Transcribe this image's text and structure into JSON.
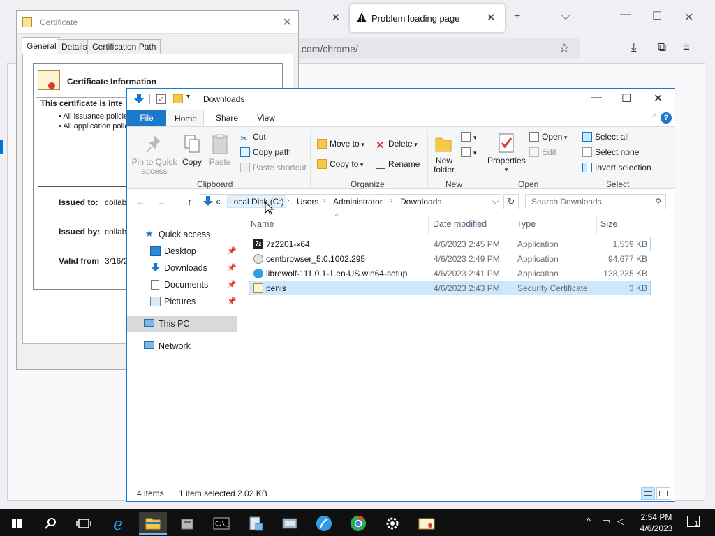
{
  "browser": {
    "tab_title": "Problem loading page",
    "url_fragment": ".com/chrome/"
  },
  "certificate": {
    "window_title": "Certificate",
    "tabs": [
      "General",
      "Details",
      "Certification Path"
    ],
    "heading": "Certificate Information",
    "intended": "This certificate is inte",
    "bullets": [
      "• All issuance policie",
      "• All application polic"
    ],
    "issued_to_label": "Issued to:",
    "issued_to_value": "collabr",
    "issued_by_label": "Issued by:",
    "issued_by_value": "collabr",
    "valid_from_label": "Valid from",
    "valid_from_value": "3/16/2"
  },
  "explorer": {
    "title": "Downloads",
    "ribbon_tabs": {
      "file": "File",
      "home": "Home",
      "share": "Share",
      "view": "View"
    },
    "clipboard": {
      "pin": "Pin to Quick access",
      "copy": "Copy",
      "paste": "Paste",
      "cut": "Cut",
      "copy_path": "Copy path",
      "paste_shortcut": "Paste shortcut",
      "label": "Clipboard"
    },
    "organize": {
      "move_to": "Move to",
      "copy_to": "Copy to",
      "delete": "Delete",
      "rename": "Rename",
      "label": "Organize"
    },
    "new_group": {
      "new_folder": "New folder",
      "label": "New"
    },
    "open_group": {
      "properties": "Properties",
      "open": "Open",
      "edit": "Edit",
      "label": "Open"
    },
    "select_group": {
      "select_all": "Select all",
      "select_none": "Select none",
      "invert": "Invert selection",
      "label": "Select"
    },
    "address": {
      "overflow": "«",
      "segments": [
        "Local Disk (C:)",
        "Users",
        "Administrator",
        "Downloads"
      ]
    },
    "search_placeholder": "Search Downloads",
    "nav": {
      "quick_access": "Quick access",
      "desktop": "Desktop",
      "downloads": "Downloads",
      "documents": "Documents",
      "pictures": "Pictures",
      "this_pc": "This PC",
      "network": "Network"
    },
    "columns": {
      "name": "Name",
      "date": "Date modified",
      "type": "Type",
      "size": "Size"
    },
    "files": [
      {
        "name": "7z2201-x64",
        "date": "4/6/2023 2:45 PM",
        "type": "Application",
        "size": "1,539 KB",
        "icon": "7zip-icon"
      },
      {
        "name": "centbrowser_5.0.1002.295",
        "date": "4/6/2023 2:49 PM",
        "type": "Application",
        "size": "94,677 KB",
        "icon": "installer-icon"
      },
      {
        "name": "librewolf-111.0.1-1.en-US.win64-setup",
        "date": "4/6/2023 2:41 PM",
        "type": "Application",
        "size": "128,235 KB",
        "icon": "librewolf-icon"
      },
      {
        "name": "penis",
        "date": "4/6/2023 2:43 PM",
        "type": "Security Certificate",
        "size": "3 KB",
        "icon": "certificate-icon"
      }
    ],
    "status": {
      "items": "4 items",
      "selected": "1 item selected  2.02 KB"
    }
  },
  "taskbar": {
    "time": "2:54 PM",
    "date": "4/6/2023",
    "notifications": "1"
  },
  "colors": {
    "accent": "#1979ca",
    "selection": "#cce8ff",
    "taskbar": "#101010"
  }
}
